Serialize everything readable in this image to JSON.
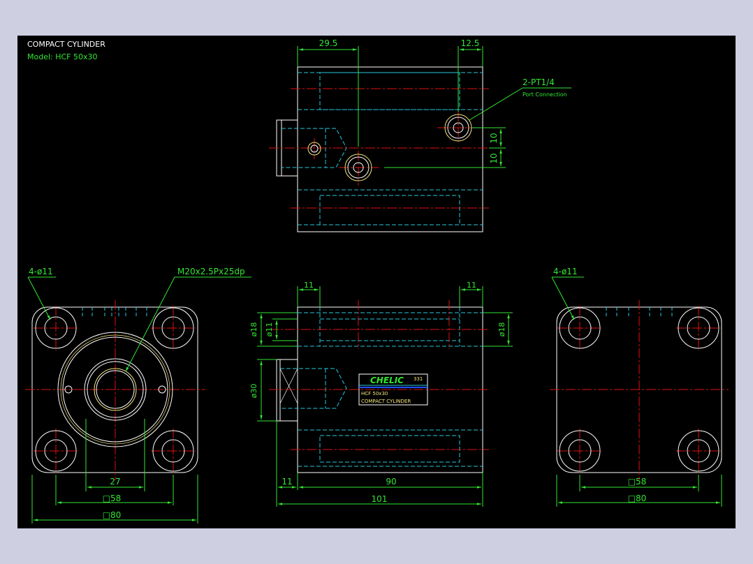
{
  "title_block": {
    "title": "COMPACT CYLINDER",
    "model": "Model:  HCF 50x30"
  },
  "colors": {
    "background": "#000000",
    "outline": "#ffffff",
    "hidden": "#29c8dc",
    "centerline": "#e01010",
    "dimension": "#33e633",
    "label_text": "#f5e77a",
    "frame": "#ced0e2"
  },
  "top_view": {
    "dim_left": "29.5",
    "dim_right": "12.5",
    "dim_v1": "10",
    "dim_v2": "10",
    "port_label": "2-PT1/4",
    "port_sublabel": "Port Connection"
  },
  "front_view": {
    "holes_label": "4-ø11",
    "thread_label": "M20x2.5Px25dp",
    "dim_27": "27",
    "dim_58": "□58",
    "dim_80": "□80"
  },
  "side_view": {
    "dim_11_left": "11",
    "dim_11_right": "11",
    "dim_d18_left": "ø18",
    "dim_d11": "ø11",
    "dim_d18_right": "ø18",
    "dim_d30": "ø30",
    "dim_11_bottom": "11",
    "dim_90": "90",
    "dim_101": "101",
    "nameplate": {
      "brand": "CHELIC",
      "code": "331",
      "model": "HCF 50x30",
      "desc": "COMPACT CYLINDER"
    }
  },
  "rear_view": {
    "holes_label": "4-ø11",
    "dim_58": "□58",
    "dim_80": "□80"
  }
}
